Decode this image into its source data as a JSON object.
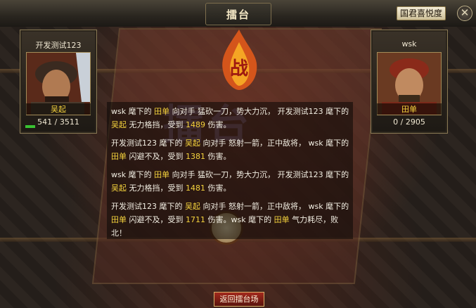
{
  "window": {
    "title": "擂台",
    "favor_button": "国君喜悦度",
    "close_symbol": "✕",
    "return_button": "返回擂台场"
  },
  "scene": {
    "banner": "擂台",
    "flame_glyph": "战"
  },
  "left_fighter": {
    "player": "开发测试123",
    "general": "吴起",
    "hp_text": "541 / 3511",
    "hp_fraction": 0.154,
    "hp_bar_color": "#39c232"
  },
  "right_fighter": {
    "player": "wsk",
    "general": "田单",
    "hp_text": "0 / 2905",
    "hp_fraction": 0
  },
  "log": [
    {
      "parts": [
        {
          "t": "wsk 麾下的 "
        },
        {
          "t": "田单",
          "hl": true
        },
        {
          "t": " 向对手 猛砍一刀，势大力沉， 开发测试123 麾下的 "
        },
        {
          "t": "吴起",
          "hl": true
        },
        {
          "t": " 无力格挡，受到 "
        },
        {
          "t": "1489",
          "hl": true
        },
        {
          "t": " 伤害。"
        }
      ]
    },
    {
      "parts": [
        {
          "t": "开发测试123 麾下的 "
        },
        {
          "t": "吴起",
          "hl": true
        },
        {
          "t": " 向对手 怒射一箭，正中敌将， wsk 麾下的 "
        },
        {
          "t": "田单",
          "hl": true
        },
        {
          "t": " 闪避不及，受到 "
        },
        {
          "t": "1381",
          "hl": true
        },
        {
          "t": " 伤害。"
        }
      ]
    },
    {
      "parts": [
        {
          "t": "wsk 麾下的 "
        },
        {
          "t": "田单",
          "hl": true
        },
        {
          "t": " 向对手 猛砍一刀，势大力沉， 开发测试123 麾下的 "
        },
        {
          "t": "吴起",
          "hl": true
        },
        {
          "t": " 无力格挡，受到 "
        },
        {
          "t": "1481",
          "hl": true
        },
        {
          "t": " 伤害。"
        }
      ]
    },
    {
      "parts": [
        {
          "t": "开发测试123 麾下的 "
        },
        {
          "t": "吴起",
          "hl": true
        },
        {
          "t": " 向对手 怒射一箭，正中敌将， wsk 麾下的 "
        },
        {
          "t": "田单",
          "hl": true
        },
        {
          "t": " 闪避不及，受到 "
        },
        {
          "t": "1711",
          "hl": true
        },
        {
          "t": " 伤害。wsk 麾下的 "
        },
        {
          "t": "田单",
          "hl": true
        },
        {
          "t": " 气力耗尽，败北！"
        }
      ]
    }
  ],
  "colors": {
    "highlight": "#f5d33d",
    "text": "#f2eee2",
    "frame_gold": "#8a7a55"
  }
}
